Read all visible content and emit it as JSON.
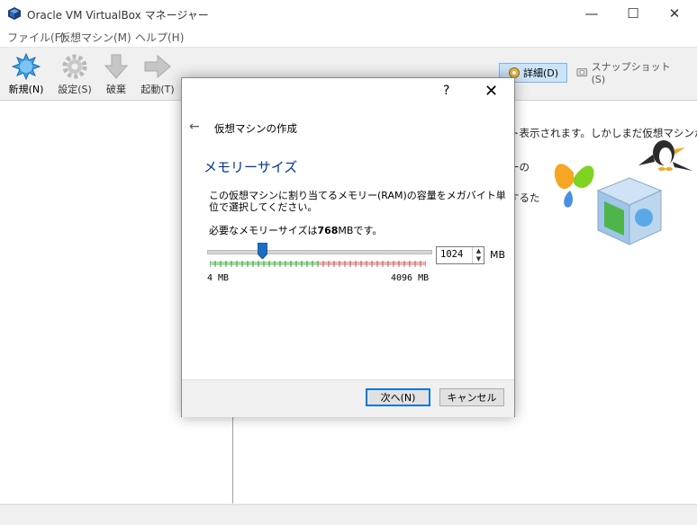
{
  "window": {
    "title": "Oracle VM VirtualBox マネージャー",
    "minimize": "—",
    "maximize": "☐",
    "close": "✕"
  },
  "menu": [
    {
      "label": "ファイル(F)"
    },
    {
      "label": "仮想マシン(M)"
    },
    {
      "label": "ヘルプ(H)"
    }
  ],
  "toolbar": {
    "new_label": "新規(N)",
    "settings_label": "設定(S)",
    "discard_label": "破棄",
    "start_label": "起動(T)"
  },
  "tools": {
    "details_label": "詳細(D)",
    "snapshots_label": "スナップショット(S)"
  },
  "welcome": {
    "line1": "ト表示されます。しかしまだ仮想マシンが",
    "line2": "ーの",
    "line3": "するた"
  },
  "dialog": {
    "help": "?",
    "close": "✕",
    "back": "←",
    "wizard_title": "仮想マシンの作成",
    "page_heading": "メモリーサイズ",
    "description": "この仮想マシンに割り当てるメモリー(RAM)の容量をメガバイト単位で選択してください。",
    "recommend_prefix": "必要なメモリーサイズは",
    "recommend_value": "768",
    "recommend_suffix": "MBです。",
    "memory": {
      "min_mb": 4,
      "max_mb": 4096,
      "value_mb": 1024,
      "min_label": "4 MB",
      "max_label": "4096 MB",
      "spin_value": "1024",
      "unit": "MB"
    },
    "next_button": "次へ(N)",
    "cancel_button": "キャンセル"
  },
  "colors": {
    "heading": "#003399",
    "scale_green": "#57c957",
    "scale_red": "#e27a7a",
    "slider_thumb": "#1b6ec2",
    "focus_border": "#0078d7",
    "details_selected_bg": "#cce4f7"
  }
}
